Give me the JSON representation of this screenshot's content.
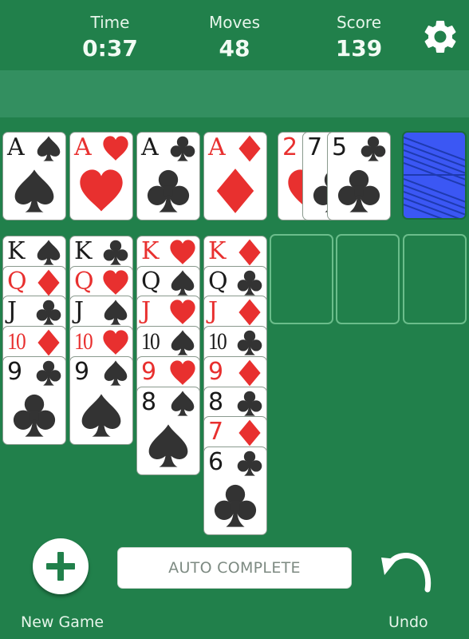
{
  "header": {
    "time_label": "Time",
    "time_value": "0:37",
    "moves_label": "Moves",
    "moves_value": "48",
    "score_label": "Score",
    "score_value": "139",
    "settings_icon": "gear-icon"
  },
  "colors": {
    "felt": "#21804b",
    "band": "#338f60",
    "red_suit": "#e8302f",
    "black_suit": "#333333",
    "card_back": "#3b57f4"
  },
  "foundations": [
    {
      "rank": "A",
      "suit": "spades"
    },
    {
      "rank": "A",
      "suit": "hearts"
    },
    {
      "rank": "A",
      "suit": "clubs"
    },
    {
      "rank": "A",
      "suit": "diamonds"
    }
  ],
  "waste": [
    {
      "rank": "2",
      "suit": "hearts"
    },
    {
      "rank": "7",
      "suit": "clubs"
    },
    {
      "rank": "5",
      "suit": "clubs"
    }
  ],
  "stock": {
    "face_down": true
  },
  "tableau": [
    [
      {
        "rank": "K",
        "suit": "spades"
      },
      {
        "rank": "Q",
        "suit": "diamonds"
      },
      {
        "rank": "J",
        "suit": "clubs"
      },
      {
        "rank": "10",
        "suit": "diamonds"
      },
      {
        "rank": "9",
        "suit": "clubs"
      }
    ],
    [
      {
        "rank": "K",
        "suit": "clubs"
      },
      {
        "rank": "Q",
        "suit": "hearts"
      },
      {
        "rank": "J",
        "suit": "spades"
      },
      {
        "rank": "10",
        "suit": "hearts"
      },
      {
        "rank": "9",
        "suit": "spades"
      }
    ],
    [
      {
        "rank": "K",
        "suit": "hearts"
      },
      {
        "rank": "Q",
        "suit": "spades"
      },
      {
        "rank": "J",
        "suit": "hearts"
      },
      {
        "rank": "10",
        "suit": "spades"
      },
      {
        "rank": "9",
        "suit": "hearts"
      },
      {
        "rank": "8",
        "suit": "spades"
      }
    ],
    [
      {
        "rank": "K",
        "suit": "diamonds"
      },
      {
        "rank": "Q",
        "suit": "clubs"
      },
      {
        "rank": "J",
        "suit": "diamonds"
      },
      {
        "rank": "10",
        "suit": "clubs"
      },
      {
        "rank": "9",
        "suit": "diamonds"
      },
      {
        "rank": "8",
        "suit": "clubs"
      },
      {
        "rank": "7",
        "suit": "diamonds"
      },
      {
        "rank": "6",
        "suit": "clubs"
      }
    ],
    [],
    [],
    []
  ],
  "footer": {
    "new_game_label": "New Game",
    "auto_complete_label": "AUTO COMPLETE",
    "undo_label": "Undo"
  }
}
